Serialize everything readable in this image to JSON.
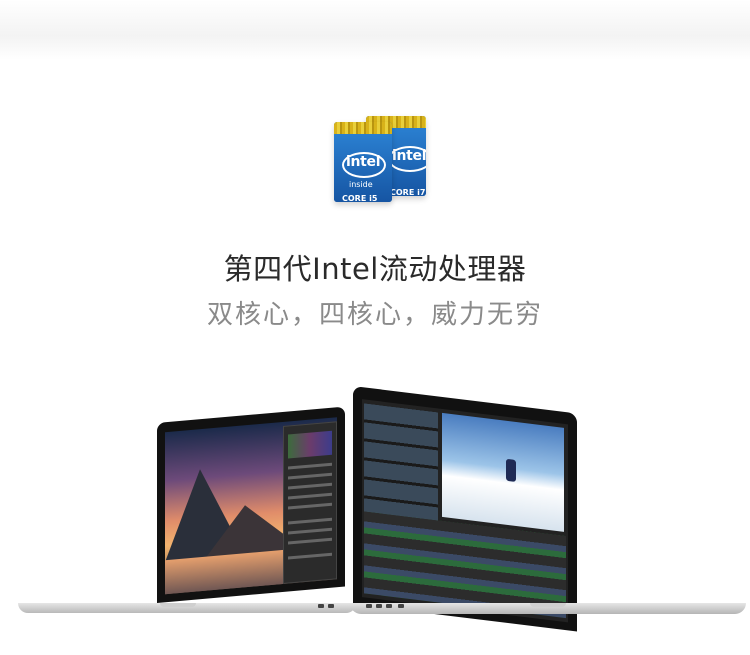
{
  "badges": {
    "front": {
      "brand": "intel",
      "tag": "inside",
      "line": "CORE i5"
    },
    "back": {
      "brand": "intel",
      "tag": "inside",
      "line": "CORE i7"
    }
  },
  "headline": "第四代Intel流动处理器",
  "subline": "双核心，四核心，威力无穷",
  "colors": {
    "headline": "#2a2a2a",
    "subline": "#8a8a8a",
    "badge_blue": "#1a6cc0",
    "badge_gold": "#d8b21a"
  },
  "images": {
    "left_laptop": "laptop-with-landscape-photo-editing",
    "right_laptop": "laptop-with-video-editing-skier"
  }
}
